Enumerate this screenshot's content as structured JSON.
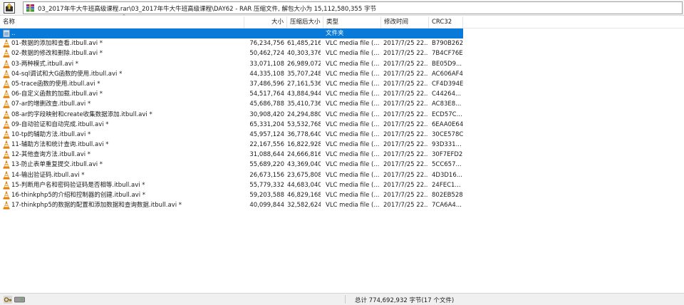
{
  "toolbar": {
    "path": "03_2017年牛大牛班高级课程.rar\\03_2017年牛大牛班高级课程\\DAY62 - RAR 压缩文件, 解包大小为 15,112,580,355 字节"
  },
  "columns": {
    "name": "名称",
    "size": "大小",
    "packed": "压缩后大小",
    "type": "类型",
    "modified": "修改时间",
    "crc": "CRC32"
  },
  "parent_row": {
    "name": "..",
    "type": "文件夹"
  },
  "files": [
    {
      "name": "01-数据的添加和查看.itbull.avi *",
      "size": "76,234,756",
      "packed": "61,485,216",
      "type": "VLC media file (....",
      "modified": "2017/7/25 22...",
      "crc": "B790B262"
    },
    {
      "name": "02-数据的修改和删除.itbull.avi *",
      "size": "50,462,724",
      "packed": "40,303,376",
      "type": "VLC media file (....",
      "modified": "2017/7/25 22...",
      "crc": "7B4CF76E"
    },
    {
      "name": "03-两种模式.itbull.avi *",
      "size": "33,071,108",
      "packed": "26,989,072",
      "type": "VLC media file (....",
      "modified": "2017/7/25 22...",
      "crc": "BE05D9..."
    },
    {
      "name": "04-sql调试和大G函数的使用.itbull.avi *",
      "size": "44,335,108",
      "packed": "35,707,248",
      "type": "VLC media file (....",
      "modified": "2017/7/25 22...",
      "crc": "AC606AF4"
    },
    {
      "name": "05-trace函数的使用.itbull.avi *",
      "size": "37,486,596",
      "packed": "27,161,536",
      "type": "VLC media file (....",
      "modified": "2017/7/25 22...",
      "crc": "CF4D394E"
    },
    {
      "name": "06-自定义函数的加载.itbull.avi *",
      "size": "54,517,764",
      "packed": "43,884,944",
      "type": "VLC media file (....",
      "modified": "2017/7/25 22...",
      "crc": "C44264..."
    },
    {
      "name": "07-ar的增删改查.itbull.avi *",
      "size": "45,686,788",
      "packed": "35,410,736",
      "type": "VLC media file (....",
      "modified": "2017/7/25 22...",
      "crc": "AC83E8..."
    },
    {
      "name": "08-ar的字段映射和create收集数据添加.itbull.avi *",
      "size": "30,908,420",
      "packed": "24,294,880",
      "type": "VLC media file (....",
      "modified": "2017/7/25 22...",
      "crc": "ECD57C..."
    },
    {
      "name": "09-自动验证和自动完成.itbull.avi *",
      "size": "65,331,204",
      "packed": "53,532,768",
      "type": "VLC media file (....",
      "modified": "2017/7/25 22...",
      "crc": "6EAA0E64"
    },
    {
      "name": "10-tp的辅助方法.itbull.avi *",
      "size": "45,957,124",
      "packed": "36,778,640",
      "type": "VLC media file (....",
      "modified": "2017/7/25 22...",
      "crc": "30CE578C"
    },
    {
      "name": "11-辅助方法和统计查询.itbull.avi *",
      "size": "22,167,556",
      "packed": "16,822,928",
      "type": "VLC media file (....",
      "modified": "2017/7/25 22...",
      "crc": "93D331..."
    },
    {
      "name": "12-其他查询方法.itbull.avi *",
      "size": "31,088,644",
      "packed": "24,666,816",
      "type": "VLC media file (....",
      "modified": "2017/7/25 22...",
      "crc": "30F7EFD2"
    },
    {
      "name": "13-防止表单重复提交.itbull.avi *",
      "size": "55,689,220",
      "packed": "43,369,040",
      "type": "VLC media file (....",
      "modified": "2017/7/25 22...",
      "crc": "5CC657..."
    },
    {
      "name": "14-输出验证码.itbull.avi *",
      "size": "26,673,156",
      "packed": "23,675,808",
      "type": "VLC media file (....",
      "modified": "2017/7/25 22...",
      "crc": "4D3D16..."
    },
    {
      "name": "15-判断用户名和密码验证码是否相等.itbull.avi *",
      "size": "55,779,332",
      "packed": "44,683,040",
      "type": "VLC media file (....",
      "modified": "2017/7/25 22...",
      "crc": "24FEC1..."
    },
    {
      "name": "16-thinkphp5的介绍和控制器的创建.itbull.avi *",
      "size": "59,203,588",
      "packed": "46,829,168",
      "type": "VLC media file (....",
      "modified": "2017/7/25 22...",
      "crc": "802EB528"
    },
    {
      "name": "17-thinkphp5的数据的配置和添加数据和查询数据.itbull.avi *",
      "size": "40,099,844",
      "packed": "32,582,624",
      "type": "VLC media file (....",
      "modified": "2017/7/25 22...",
      "crc": "7CA6A4..."
    }
  ],
  "status": {
    "summary": "总计 774,692,932 字节(17 个文件)"
  },
  "icons": {
    "up": "up-folder-icon",
    "archive": "rar-archive-icon",
    "file": "vlc-cone-icon",
    "folder": "parent-folder-icon",
    "key": "key-icon",
    "drive": "drive-icon"
  }
}
